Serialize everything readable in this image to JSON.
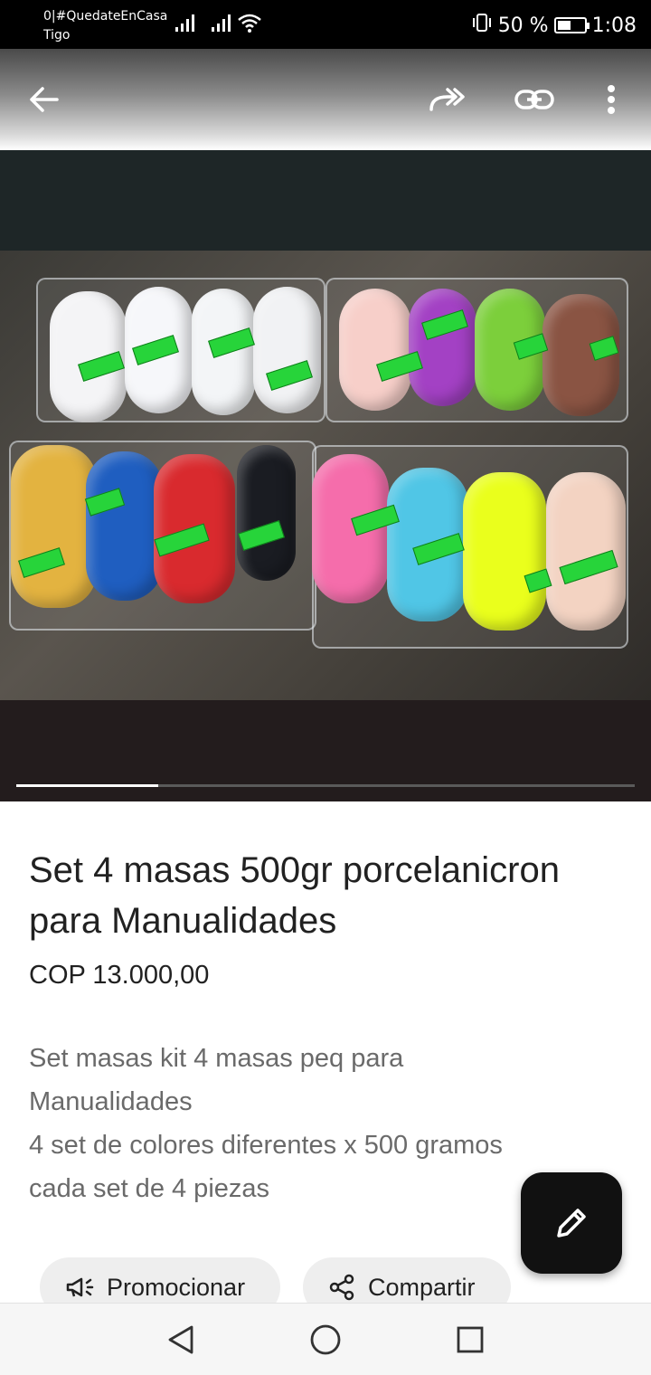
{
  "status_bar": {
    "carrier_line1": "0|#QuedateEnCasa",
    "carrier_line2": "Tigo",
    "battery_text": "50 %",
    "battery_level": 0.5,
    "time": "1:08",
    "icons": [
      "signal-icon",
      "signal-icon",
      "wifi-icon",
      "vibrate-icon",
      "battery-icon"
    ]
  },
  "toolbar": {
    "back_icon": "arrow-left-icon",
    "forward_icon": "share-forward-icon",
    "link_icon": "link-icon",
    "more_icon": "more-vert-icon"
  },
  "gallery": {
    "image_alt": "product-photo",
    "progress": 0.23
  },
  "product": {
    "title": "Set 4 masas 500gr porcelanicron para Manualidades",
    "price": "COP 13.000,00",
    "description": [
      "Set masas kit 4 masas peq para",
      "Manualidades",
      "4 set de colores diferentes x 500 gramos",
      "cada set de 4 piezas"
    ]
  },
  "fab": {
    "icon": "pencil-icon"
  },
  "actions": {
    "promote_label": "Promocionar",
    "promote_icon": "megaphone-icon",
    "share_label": "Compartir",
    "share_icon": "share-icon"
  },
  "nav": {
    "back_icon": "nav-back-icon",
    "home_icon": "nav-home-icon",
    "recents_icon": "nav-recents-icon"
  },
  "colors": {
    "toolbar_dark": "#4a4a4a",
    "fab_bg": "#111111",
    "chip_bg": "#eeeeee",
    "desc_text": "#6a6a6a"
  }
}
